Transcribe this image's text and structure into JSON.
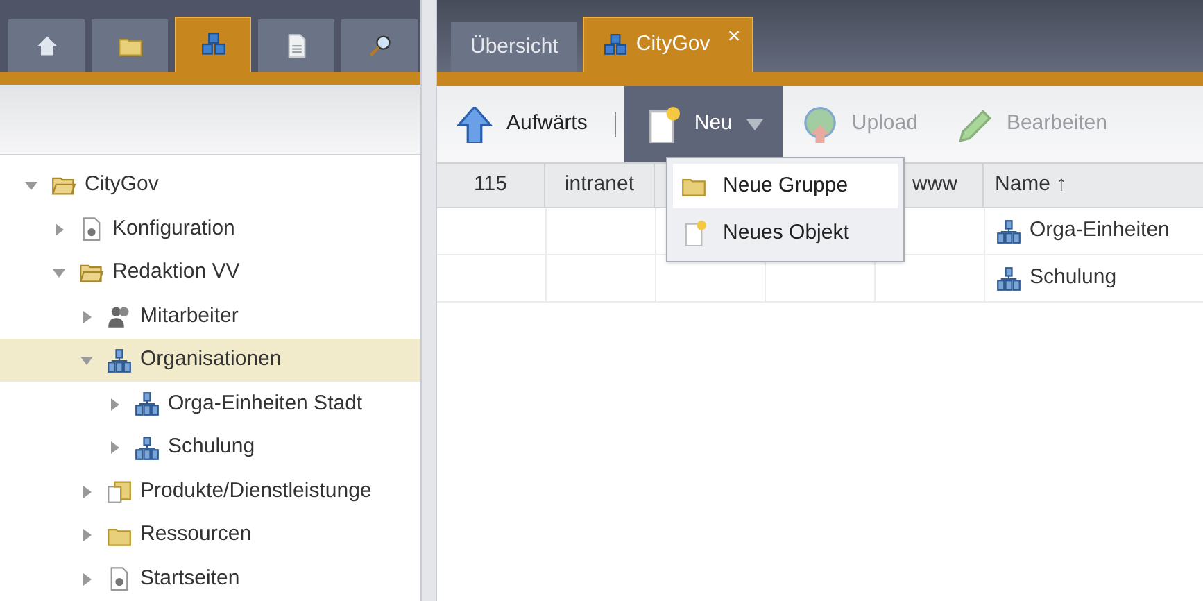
{
  "left_tabs": [
    {
      "kind": "home",
      "selected": false
    },
    {
      "kind": "folder",
      "selected": false
    },
    {
      "kind": "cubes",
      "selected": true
    },
    {
      "kind": "document",
      "selected": false
    },
    {
      "kind": "search",
      "selected": false
    }
  ],
  "tree": [
    {
      "label": "CityGov",
      "kind": "folder-open",
      "expanded": true,
      "selected": false,
      "children": [
        {
          "label": "Konfiguration",
          "kind": "config",
          "expanded": false,
          "selected": false
        },
        {
          "label": "Redaktion VV",
          "kind": "folder-open",
          "expanded": true,
          "selected": false,
          "children": [
            {
              "label": "Mitarbeiter",
              "kind": "people",
              "expanded": false,
              "selected": false
            },
            {
              "label": "Organisationen",
              "kind": "org",
              "expanded": true,
              "selected": true,
              "children": [
                {
                  "label": "Orga-Einheiten Stadt",
                  "kind": "org",
                  "expanded": false,
                  "selected": false
                },
                {
                  "label": "Schulung",
                  "kind": "org",
                  "expanded": false,
                  "selected": false
                }
              ]
            },
            {
              "label": "Produkte/Dienstleistunge",
              "kind": "folder-doc",
              "expanded": false,
              "selected": false
            },
            {
              "label": "Ressourcen",
              "kind": "folder",
              "expanded": false,
              "selected": false
            },
            {
              "label": "Startseiten",
              "kind": "config",
              "expanded": false,
              "selected": false
            }
          ]
        }
      ]
    }
  ],
  "tabs": [
    {
      "label": "Übersicht",
      "selected": false
    },
    {
      "label": "CityGov",
      "selected": true,
      "close": "×"
    }
  ],
  "toolbar": [
    {
      "label": "Aufwärts",
      "kind": "up",
      "disabled": false,
      "open": false
    },
    {
      "label": "Neu",
      "kind": "new",
      "disabled": false,
      "open": true
    },
    {
      "label": "Upload",
      "kind": "upload",
      "disabled": true,
      "open": false
    },
    {
      "label": "Bearbeiten",
      "kind": "edit",
      "disabled": true,
      "open": false
    }
  ],
  "menu": [
    {
      "label": "Neue Gruppe",
      "kind": "folder",
      "selected": true
    },
    {
      "label": "Neues Objekt",
      "kind": "new",
      "selected": false
    }
  ],
  "table": {
    "columns": [
      "115",
      "intranet",
      "www",
      "Name ↑"
    ],
    "rows": [
      {
        "name": "Orga-Einheiten"
      },
      {
        "name": "Schulung"
      }
    ]
  }
}
